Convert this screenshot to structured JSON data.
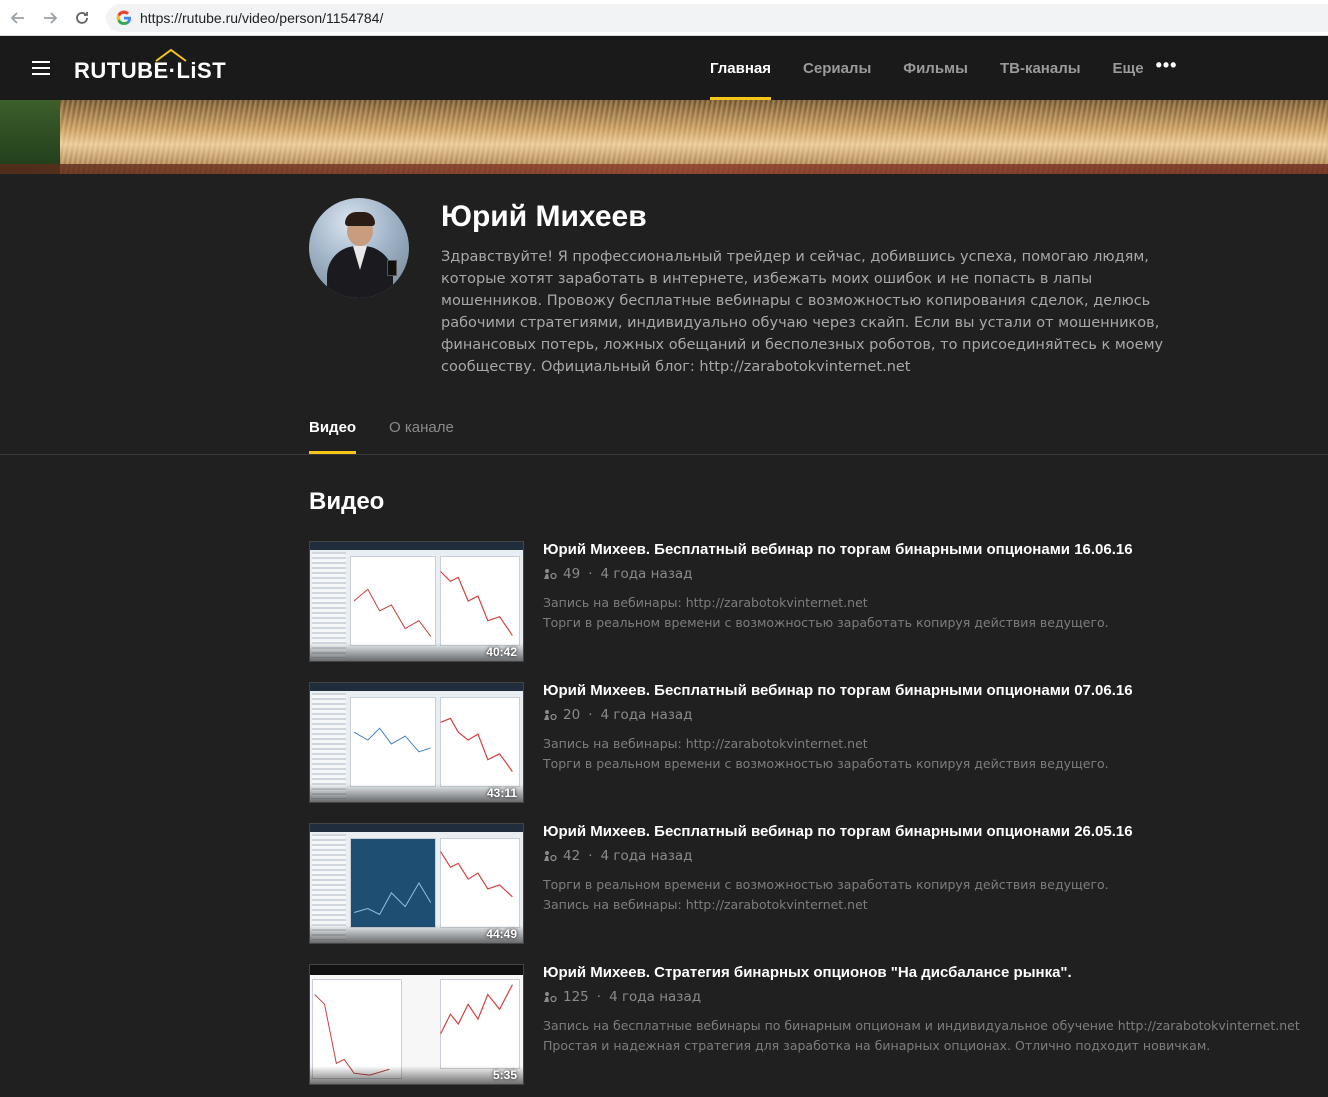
{
  "browser": {
    "url": "https://rutube.ru/video/person/1154784/"
  },
  "header": {
    "logo_text": "RUTUBE·LiST",
    "nav": [
      {
        "label": "Главная"
      },
      {
        "label": "Сериалы"
      },
      {
        "label": "Фильмы"
      },
      {
        "label": "ТВ-каналы"
      },
      {
        "label": "Еще"
      }
    ],
    "accent_color": "#f5c518"
  },
  "profile": {
    "name": "Юрий Михеев",
    "description": "Здравствуйте! Я профессиональный трейдер и сейчас, добившись успеха, помогаю людям, которые хотят заработать в интернете, избежать моих ошибок и не попасть в лапы мошенников. Провожу бесплатные вебинары с возможностью копирования сделок, делюсь рабочими стратегиями, индивидуально обучаю через скайп. Если вы устали от мошенников, финансовых потерь, ложных обещаний и бесполезных роботов, то присоединяйтесь к моему сообществу. Официальный блог: http://zarabotokvinternet.net"
  },
  "tabs": [
    {
      "label": "Видео"
    },
    {
      "label": "О канале"
    }
  ],
  "section_title": "Видео",
  "videos": [
    {
      "title": "Юрий Михеев. Бесплатный вебинар по торгам бинарными опционами 16.06.16",
      "views": "49",
      "age": "4 года назад",
      "desc1": "Запись на вебинары: http://zarabotokvinternet.net",
      "desc2": "Торги в реальном времени с возможностью заработать копируя действия ведущего.",
      "duration": "40:42"
    },
    {
      "title": "Юрий Михеев. Бесплатный вебинар по торгам бинарными опционами 07.06.16",
      "views": "20",
      "age": "4 года назад",
      "desc1": "Запись на вебинары: http://zarabotokvinternet.net",
      "desc2": "Торги в реальном времени с возможностью заработать копируя действия ведущего.",
      "duration": "43:11"
    },
    {
      "title": "Юрий Михеев. Бесплатный вебинар по торгам бинарными опционами 26.05.16",
      "views": "42",
      "age": "4 года назад",
      "desc1": "Торги в реальном времени с возможностью заработать копируя действия ведущего.",
      "desc2": "Запись на вебинары: http://zarabotokvinternet.net",
      "duration": "44:49"
    },
    {
      "title": "Юрий Михеев. Стратегия бинарных опционов \"На дисбалансе рынка\".",
      "views": "125",
      "age": "4 года назад",
      "desc1": "Запись на бесплатные вебинары по бинарным опционам и индивидуальное обучение http://zarabotokvinternet.net",
      "desc2": "Простая и надежная стратегия для заработка на бинарных опционах. Отлично подходит новичкам.",
      "duration": "5:35"
    }
  ]
}
